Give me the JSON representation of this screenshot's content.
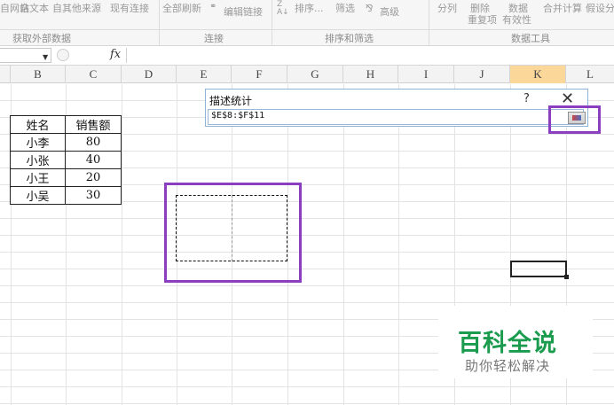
{
  "ribbon": {
    "items": [
      "自网站",
      "自文本",
      "自其他来源",
      "现有连接",
      "全部刷新",
      "编辑链接",
      "排序...",
      "筛选",
      "高级",
      "分列",
      "删除",
      "重复项",
      "数据",
      "有效性",
      "合并计算",
      "假设分"
    ],
    "groups": [
      "获取外部数据",
      "连接",
      "排序和筛选",
      "数据工具"
    ]
  },
  "formula_bar": {
    "fx_label": "fx",
    "content": ""
  },
  "columns": [
    "B",
    "C",
    "D",
    "E",
    "F",
    "G",
    "H",
    "I",
    "J",
    "K",
    "L"
  ],
  "selected_column": "K",
  "table": {
    "headers": [
      "姓名",
      "销售额"
    ],
    "rows": [
      [
        "小李",
        "80"
      ],
      [
        "小张",
        "40"
      ],
      [
        "小王",
        "20"
      ],
      [
        "小吴",
        "30"
      ]
    ]
  },
  "dialog": {
    "title": "描述统计",
    "help": "?",
    "close": "✕",
    "range_value": "$E$8:$F$11"
  },
  "watermark": {
    "title": "百科全说",
    "subtitle": "助你轻松解决"
  },
  "colors": {
    "highlight": "#8a3ec0",
    "selected_column": "#fbd79a",
    "watermark_green": "#1a9b4e"
  }
}
